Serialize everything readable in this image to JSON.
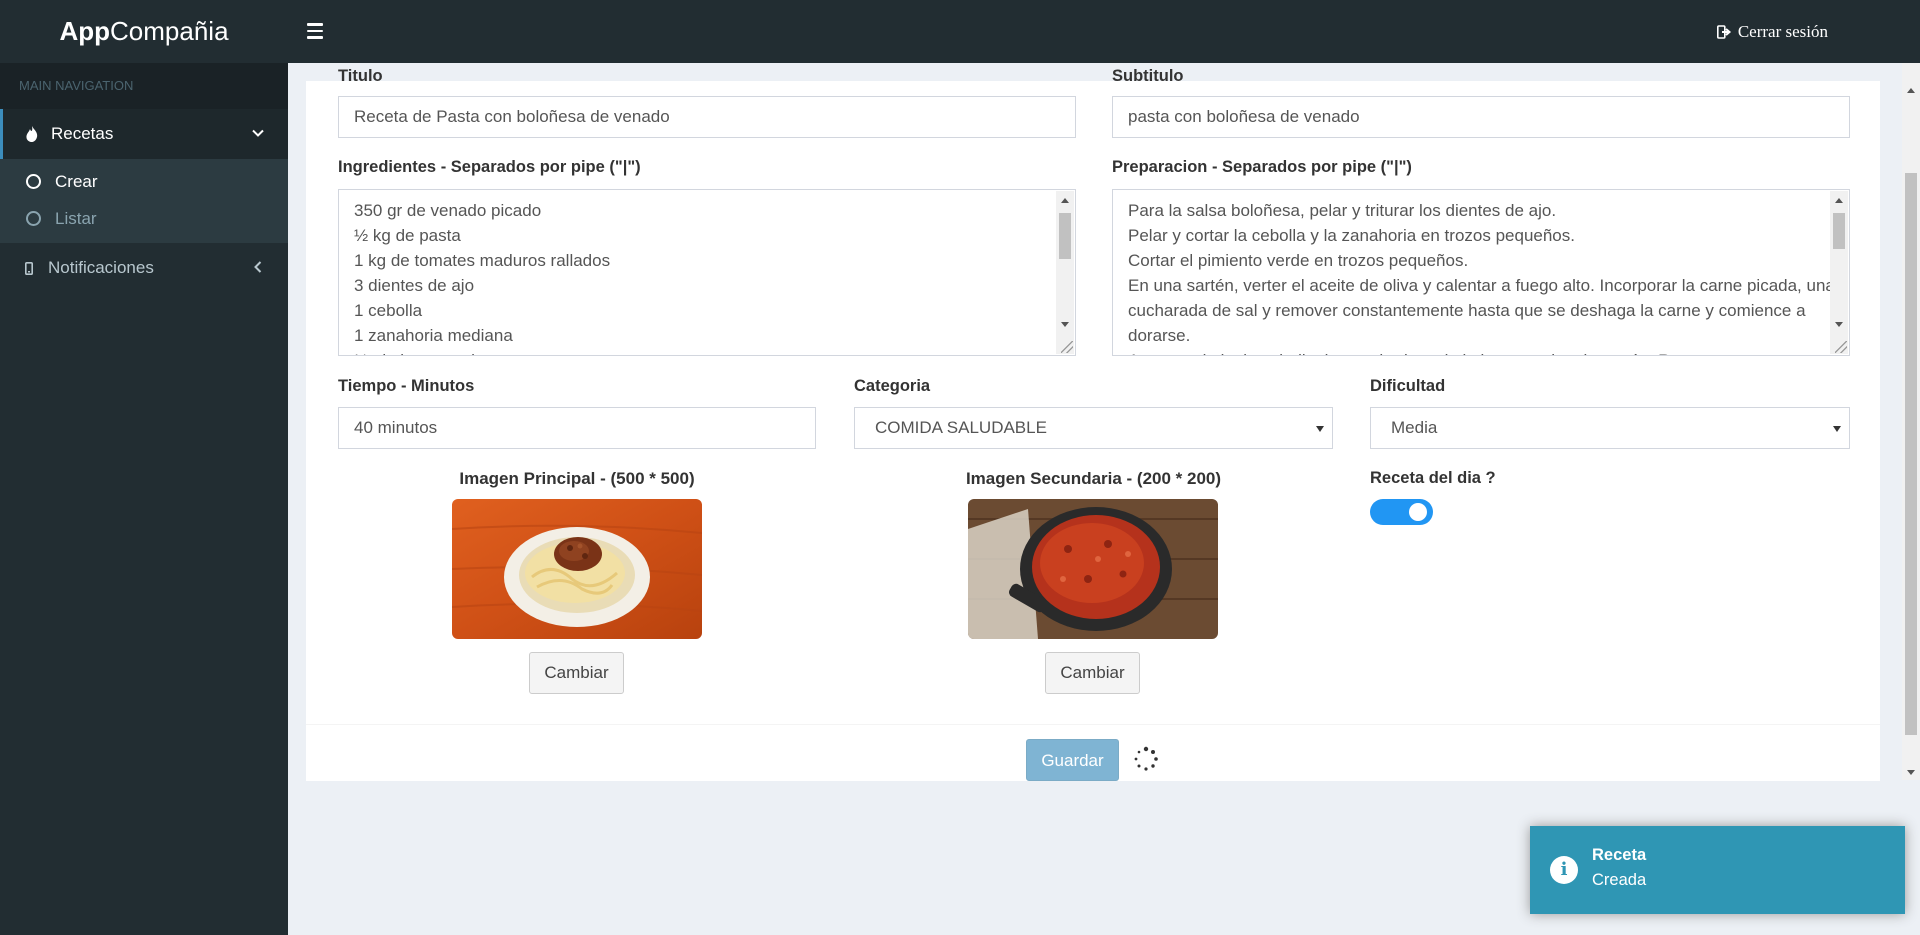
{
  "app": {
    "logo_bold": "App",
    "logo_rest": "Compañia"
  },
  "header": {
    "logout_label": "Cerrar sesión"
  },
  "sidebar": {
    "nav_header": "MAIN NAVIGATION",
    "recetas_label": "Recetas",
    "sub_items": [
      "Crear",
      "Listar"
    ],
    "notificaciones_label": "Notificaciones"
  },
  "form": {
    "titulo_label": "Titulo",
    "titulo_value": "Receta de Pasta con boloñesa de venado",
    "subtitulo_label": "Subtitulo",
    "subtitulo_value": "pasta con boloñesa de venado",
    "ingredientes_label": "Ingredientes - Separados por pipe (\"|\")",
    "ingredientes_lines": [
      "350 gr de venado picado",
      "½ kg de pasta",
      "1 kg de tomates maduros rallados",
      "3 dientes de ajo",
      "1 cebolla",
      "1 zanahoria mediana",
      "½ pimiento verde"
    ],
    "preparacion_label": "Preparacion - Separados por pipe (\"|\")",
    "preparacion_lines": [
      "Para la salsa boloñesa, pelar y triturar los dientes de ajo.",
      "Pelar y cortar la cebolla y la zanahoria en trozos pequeños.",
      "Cortar el pimiento verde en trozos pequeños.",
      "En una sartén, verter el aceite de oliva y calentar a fuego alto. Incorporar la carne picada, una",
      "cucharada de sal y remover constantemente hasta que se deshaga la carne y comience a",
      "dorarse.",
      "Agregar el ajo, la cebolla, la zanahoria y el pimiento verde a la sartén. Remover y"
    ],
    "tiempo_label": "Tiempo - Minutos",
    "tiempo_value": "40 minutos",
    "categoria_label": "Categoria",
    "categoria_value": "COMIDA SALUDABLE",
    "dificultad_label": "Dificultad",
    "dificultad_value": "Media",
    "imagen_principal_label": "Imagen Principal - (500 * 500)",
    "imagen_secundaria_label": "Imagen Secundaria - (200 * 200)",
    "cambiar_label": "Cambiar",
    "receta_dia_label": "Receta del dia ?",
    "receta_dia_on": true,
    "guardar_label": "Guardar"
  },
  "toast": {
    "title": "Receta",
    "message": "Creada",
    "icon": "info-icon"
  },
  "colors": {
    "sidebar": "#222d32",
    "primary": "#3c8dbc",
    "toggle": "#2196f3",
    "toast": "#2f96b4"
  }
}
